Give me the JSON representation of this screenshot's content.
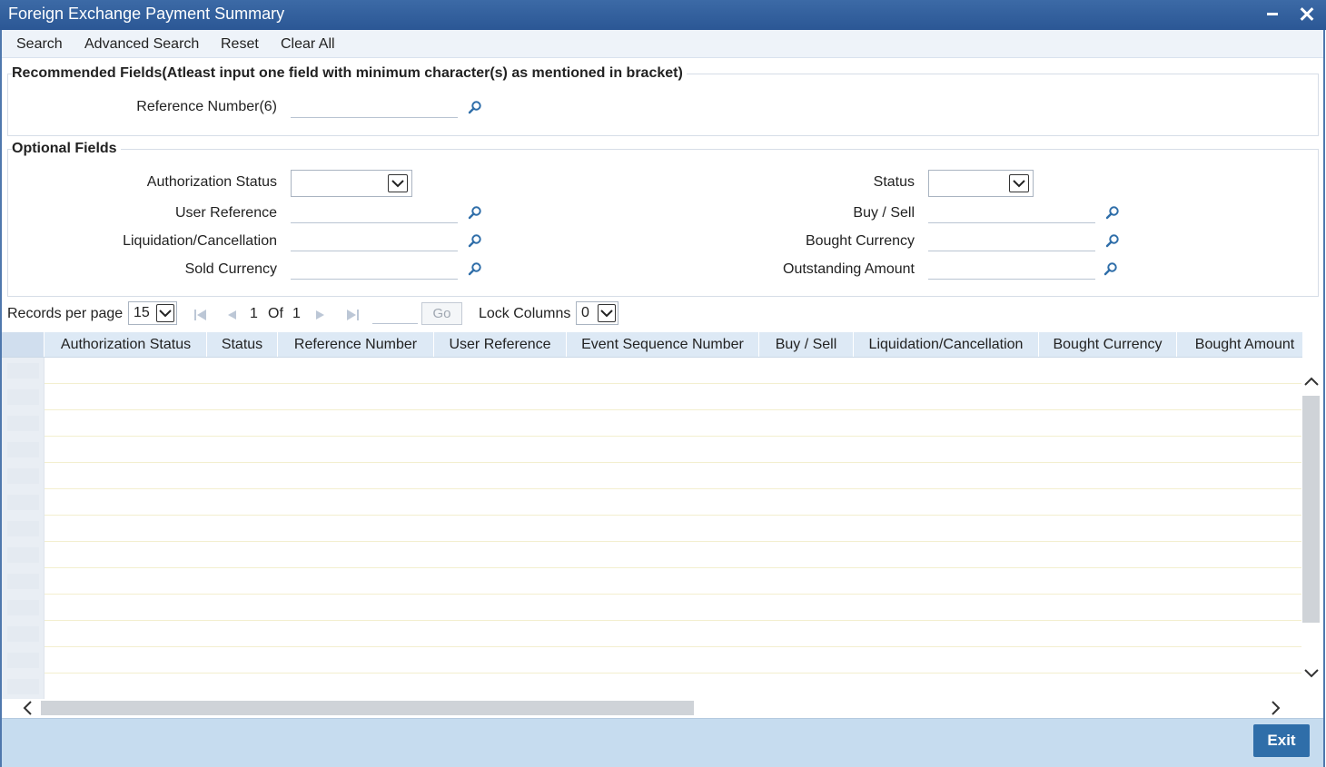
{
  "window": {
    "title": "Foreign Exchange Payment Summary"
  },
  "menu": {
    "search": "Search",
    "advanced_search": "Advanced Search",
    "reset": "Reset",
    "clear_all": "Clear All"
  },
  "recommended": {
    "legend": "Recommended Fields(Atleast input one field with minimum character(s) as mentioned in bracket)",
    "reference_number_label": "Reference Number(6)",
    "reference_number_value": ""
  },
  "optional": {
    "legend": "Optional Fields",
    "authorization_status_label": "Authorization Status",
    "authorization_status_value": "",
    "user_reference_label": "User Reference",
    "user_reference_value": "",
    "liquidation_label": "Liquidation/Cancellation",
    "liquidation_value": "",
    "sold_currency_label": "Sold Currency",
    "sold_currency_value": "",
    "status_label": "Status",
    "status_value": "",
    "buy_sell_label": "Buy / Sell",
    "buy_sell_value": "",
    "bought_currency_label": "Bought Currency",
    "bought_currency_value": "",
    "outstanding_amount_label": "Outstanding Amount",
    "outstanding_amount_value": ""
  },
  "pager": {
    "records_per_page_label": "Records per page",
    "records_per_page_value": "15",
    "current_page": "1",
    "of_label": "Of",
    "total_pages": "1",
    "goto_value": "",
    "go_label": "Go",
    "lock_columns_label": "Lock Columns",
    "lock_columns_value": "0"
  },
  "grid": {
    "columns": [
      "Authorization Status",
      "Status",
      "Reference Number",
      "User Reference",
      "Event Sequence Number",
      "Buy / Sell",
      "Liquidation/Cancellation",
      "Bought Currency",
      "Bought Amount"
    ]
  },
  "footer": {
    "exit_label": "Exit"
  },
  "colors": {
    "titlebar": "#2b5795",
    "footer": "#c6dcef",
    "exit_button": "#2f6ea9",
    "grid_header": "#dde9f5"
  }
}
